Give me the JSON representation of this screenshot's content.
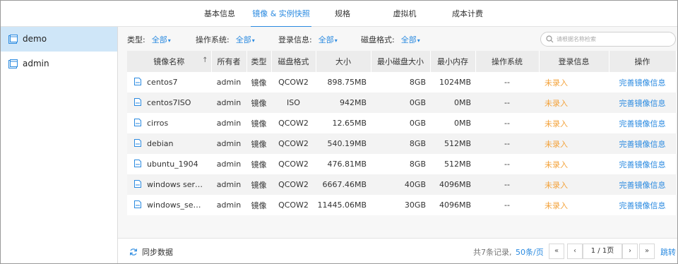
{
  "tabs": [
    {
      "label": "基本信息"
    },
    {
      "label": "镜像 & 实例快照"
    },
    {
      "label": "规格"
    },
    {
      "label": "虚拟机"
    },
    {
      "label": "成本计费"
    }
  ],
  "active_tab": 1,
  "sidebar": {
    "items": [
      {
        "label": "demo",
        "active": true
      },
      {
        "label": "admin",
        "active": false
      }
    ]
  },
  "filters": {
    "type": {
      "label": "类型:",
      "value": "全部"
    },
    "os": {
      "label": "操作系统:",
      "value": "全部"
    },
    "login": {
      "label": "登录信息:",
      "value": "全部"
    },
    "disk": {
      "label": "磁盘格式:",
      "value": "全部"
    }
  },
  "search": {
    "placeholder": "请根据名称检索"
  },
  "table": {
    "headers": [
      "镜像名称",
      "所有者",
      "类型",
      "磁盘格式",
      "大小",
      "最小磁盘大小",
      "最小内存",
      "操作系统",
      "登录信息",
      "操作"
    ],
    "sort_indicator": "↑",
    "rows": [
      {
        "name": "centos7",
        "owner": "admin",
        "type": "镜像",
        "disk": "QCOW2",
        "size": "898.75MB",
        "min_disk": "8GB",
        "min_mem": "1024MB",
        "os": "--",
        "login": "未录入",
        "op": "完善镜像信息"
      },
      {
        "name": "centos7ISO",
        "owner": "admin",
        "type": "镜像",
        "disk": "ISO",
        "size": "942MB",
        "min_disk": "0GB",
        "min_mem": "0MB",
        "os": "--",
        "login": "未录入",
        "op": "完善镜像信息"
      },
      {
        "name": "cirros",
        "owner": "admin",
        "type": "镜像",
        "disk": "QCOW2",
        "size": "12.65MB",
        "min_disk": "0GB",
        "min_mem": "0MB",
        "os": "--",
        "login": "未录入",
        "op": "完善镜像信息"
      },
      {
        "name": "debian",
        "owner": "admin",
        "type": "镜像",
        "disk": "QCOW2",
        "size": "540.19MB",
        "min_disk": "8GB",
        "min_mem": "512MB",
        "os": "--",
        "login": "未录入",
        "op": "完善镜像信息"
      },
      {
        "name": "ubuntu_1904",
        "owner": "admin",
        "type": "镜像",
        "disk": "QCOW2",
        "size": "476.81MB",
        "min_disk": "8GB",
        "min_mem": "512MB",
        "os": "--",
        "login": "未录入",
        "op": "完善镜像信息"
      },
      {
        "name": "windows serv...",
        "owner": "admin",
        "type": "镜像",
        "disk": "QCOW2",
        "size": "6667.46MB",
        "min_disk": "40GB",
        "min_mem": "4096MB",
        "os": "--",
        "login": "未录入",
        "op": "完善镜像信息"
      },
      {
        "name": "windows_serv...",
        "owner": "admin",
        "type": "镜像",
        "disk": "QCOW2",
        "size": "11445.06MB",
        "min_disk": "30GB",
        "min_mem": "4096MB",
        "os": "--",
        "login": "未录入",
        "op": "完善镜像信息"
      }
    ]
  },
  "footer": {
    "sync_label": "同步数据",
    "records": "共7条记录,",
    "per_page": "50条/页",
    "first": "«",
    "prev": "‹",
    "page": "1 / 1页",
    "next": "›",
    "last": "»",
    "jump": "跳转"
  },
  "colors": {
    "accent": "#2a8ae0",
    "warning": "#f3a23a",
    "sidebar_active": "#cfe6f8"
  },
  "icons": {
    "sidebar": "folder-window-icon",
    "row": "document-icon",
    "search": "search-icon",
    "sync": "refresh-icon"
  }
}
